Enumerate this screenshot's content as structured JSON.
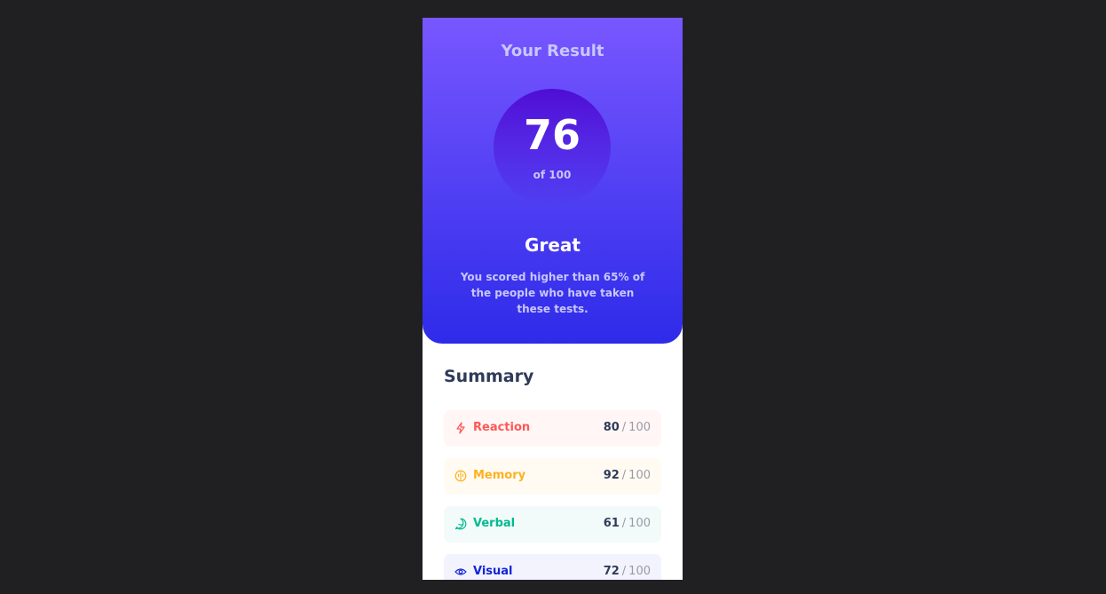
{
  "result": {
    "title": "Your Result",
    "score": "76",
    "score_total": "of 100",
    "rating": "Great",
    "description": "You scored higher than 65% of the people who have taken these tests."
  },
  "summary": {
    "title": "Summary",
    "separator": "/",
    "items": [
      {
        "label": "Reaction",
        "score": "80",
        "max": "100",
        "icon": "lightning-icon",
        "color": "#ff5757",
        "bg": "#fff6f5"
      },
      {
        "label": "Memory",
        "score": "92",
        "max": "100",
        "icon": "brain-icon",
        "color": "#ffb01f",
        "bg": "#fffbf2"
      },
      {
        "label": "Verbal",
        "score": "61",
        "max": "100",
        "icon": "chat-bubble-icon",
        "color": "#00bb8f",
        "bg": "#f2fbfa"
      },
      {
        "label": "Visual",
        "score": "72",
        "max": "100",
        "icon": "eye-icon",
        "color": "#1125d6",
        "bg": "#f3f3fd"
      }
    ]
  },
  "colors": {
    "page_background": "#202022",
    "gradient_top": "#7857ff",
    "gradient_bottom": "#2e2be9",
    "muted_text": "#c8c7ff",
    "dark_text": "#303b59"
  }
}
